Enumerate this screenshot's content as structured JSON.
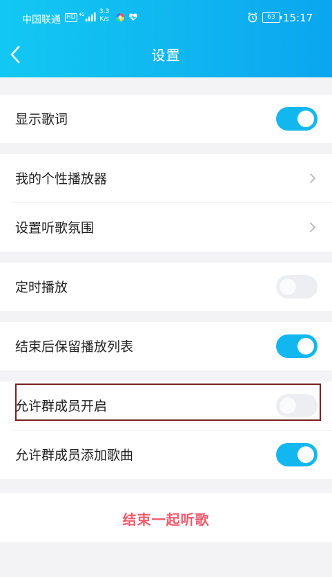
{
  "status_bar": {
    "carrier": "中国联通",
    "hd_badge": "HD",
    "network_speed_value": "3.3",
    "network_speed_unit": "K/s",
    "battery": "63",
    "time": "15:17"
  },
  "header": {
    "title": "设置"
  },
  "settings": {
    "show_lyrics": {
      "label": "显示歌词",
      "enabled": true
    },
    "my_player": {
      "label": "我的个性播放器"
    },
    "listen_mood": {
      "label": "设置听歌氛围"
    },
    "timer_play": {
      "label": "定时播放",
      "enabled": false
    },
    "keep_playlist": {
      "label": "结束后保留播放列表",
      "enabled": true
    },
    "allow_members_start": {
      "label": "允许群成员开启",
      "enabled": false
    },
    "allow_members_add": {
      "label": "允许群成员添加歌曲",
      "enabled": true
    }
  },
  "actions": {
    "end_listen_together": "结束一起听歌"
  },
  "colors": {
    "accent": "#13b7f0",
    "danger": "#f05b6c",
    "highlight_border": "#7a1f1f"
  }
}
